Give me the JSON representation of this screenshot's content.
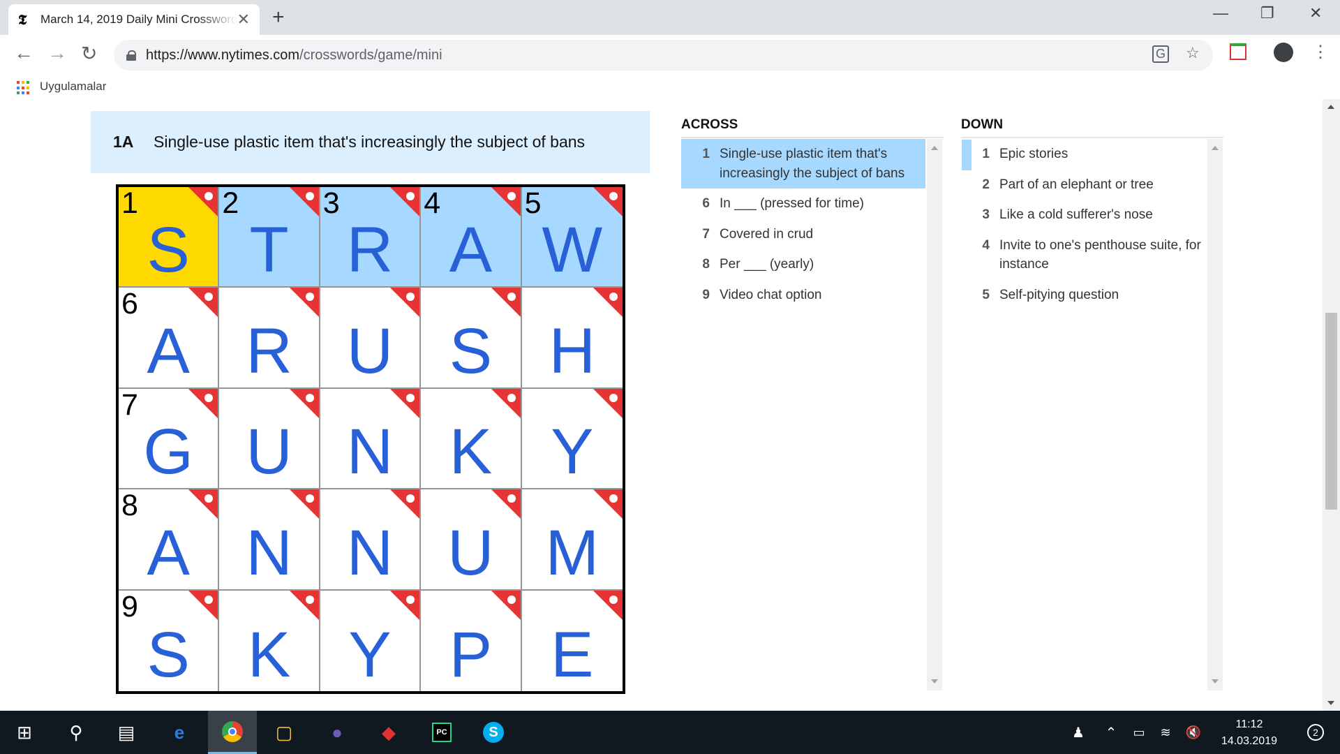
{
  "browser": {
    "tab_title": "March 14, 2019 Daily Mini Crossword",
    "tab_favicon": "𝕿",
    "tab_close": "✕",
    "new_tab": "+",
    "url_host": "https://www.nytimes.com",
    "url_path": "/crosswords/game/mini",
    "bookmarks_label": "Uygulamalar"
  },
  "current_clue": {
    "number": "1A",
    "text": "Single-use plastic item that's increasingly the subject of bans"
  },
  "grid": {
    "cells": [
      {
        "num": "1",
        "letter": "S",
        "state": "selected"
      },
      {
        "num": "2",
        "letter": "T",
        "state": "word"
      },
      {
        "num": "3",
        "letter": "R",
        "state": "word"
      },
      {
        "num": "4",
        "letter": "A",
        "state": "word"
      },
      {
        "num": "5",
        "letter": "W",
        "state": "word"
      },
      {
        "num": "6",
        "letter": "A",
        "state": ""
      },
      {
        "num": "",
        "letter": "R",
        "state": ""
      },
      {
        "num": "",
        "letter": "U",
        "state": ""
      },
      {
        "num": "",
        "letter": "S",
        "state": ""
      },
      {
        "num": "",
        "letter": "H",
        "state": ""
      },
      {
        "num": "7",
        "letter": "G",
        "state": ""
      },
      {
        "num": "",
        "letter": "U",
        "state": ""
      },
      {
        "num": "",
        "letter": "N",
        "state": ""
      },
      {
        "num": "",
        "letter": "K",
        "state": ""
      },
      {
        "num": "",
        "letter": "Y",
        "state": ""
      },
      {
        "num": "8",
        "letter": "A",
        "state": ""
      },
      {
        "num": "",
        "letter": "N",
        "state": ""
      },
      {
        "num": "",
        "letter": "N",
        "state": ""
      },
      {
        "num": "",
        "letter": "U",
        "state": ""
      },
      {
        "num": "",
        "letter": "M",
        "state": ""
      },
      {
        "num": "9",
        "letter": "S",
        "state": ""
      },
      {
        "num": "",
        "letter": "K",
        "state": ""
      },
      {
        "num": "",
        "letter": "Y",
        "state": ""
      },
      {
        "num": "",
        "letter": "P",
        "state": ""
      },
      {
        "num": "",
        "letter": "E",
        "state": ""
      }
    ]
  },
  "across": {
    "heading": "ACROSS",
    "clues": [
      {
        "num": "1",
        "text": "Single-use plastic item that's increasingly the subject of bans",
        "active": true
      },
      {
        "num": "6",
        "text": "In ___ (pressed for time)",
        "active": false
      },
      {
        "num": "7",
        "text": "Covered in crud",
        "active": false
      },
      {
        "num": "8",
        "text": "Per ___ (yearly)",
        "active": false
      },
      {
        "num": "9",
        "text": "Video chat option",
        "active": false
      }
    ]
  },
  "down": {
    "heading": "DOWN",
    "clues": [
      {
        "num": "1",
        "text": "Epic stories"
      },
      {
        "num": "2",
        "text": "Part of an elephant or tree"
      },
      {
        "num": "3",
        "text": "Like a cold sufferer's nose"
      },
      {
        "num": "4",
        "text": "Invite to one's penthouse suite, for instance"
      },
      {
        "num": "5",
        "text": "Self-pitying question"
      }
    ]
  },
  "taskbar": {
    "time": "11:12",
    "date": "14.03.2019",
    "notifications": "2"
  },
  "colors": {
    "selected_cell": "#ffda00",
    "word_highlight": "#a7d8ff",
    "letter": "#2860d8",
    "check_flag": "#e63333",
    "clue_bar": "#dbefff"
  }
}
